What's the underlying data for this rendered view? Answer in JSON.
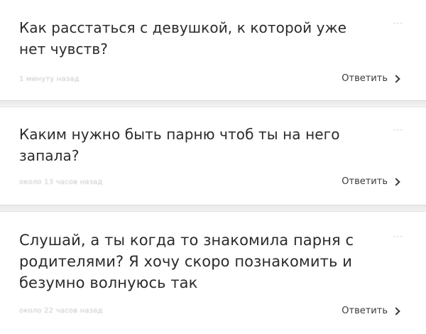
{
  "questions": [
    {
      "text": "Как расстаться с девушкой, к которой уже нет чувств?",
      "time": "1 минуту назад",
      "reply_label": "Ответить",
      "more_label": "···"
    },
    {
      "text": "Каким нужно быть парню чтоб ты на него запала?",
      "time": "около 13 часов назад",
      "reply_label": "Ответить",
      "more_label": "···"
    },
    {
      "text": "Слушай, а ты когда то знакомила парня с родителями? Я хочу скоро познакомить и безумно волнуюсь так",
      "time": "около 22 часов назад",
      "reply_label": "Ответить",
      "more_label": "···"
    }
  ]
}
